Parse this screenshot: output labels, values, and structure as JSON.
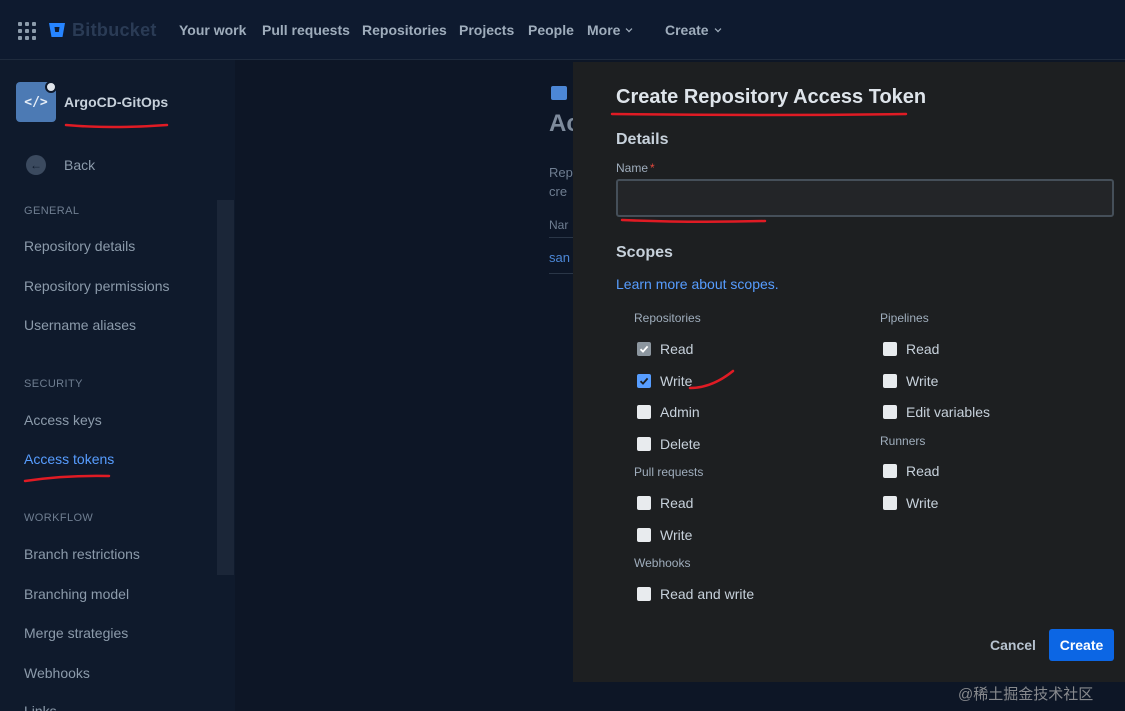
{
  "topnav": {
    "logo": "Bitbucket",
    "items": [
      "Your work",
      "Pull requests",
      "Repositories",
      "Projects",
      "People",
      "More"
    ],
    "create_label": "Create"
  },
  "sidebar": {
    "repo_name": "ArgoCD-GitOps",
    "repo_avatar_glyph": "</>",
    "back_label": "Back",
    "sections": [
      {
        "heading": "GENERAL",
        "items": [
          "Repository details",
          "Repository permissions",
          "Username aliases"
        ]
      },
      {
        "heading": "SECURITY",
        "items": [
          "Access keys",
          "Access tokens"
        ]
      },
      {
        "heading": "WORKFLOW",
        "items": [
          "Branch restrictions",
          "Branching model",
          "Merge strategies",
          "Webhooks",
          "Links"
        ]
      }
    ],
    "active_item": "Access tokens"
  },
  "background_page": {
    "title_fragment": "Ac",
    "desc_fragment_1": "Rep",
    "desc_fragment_2": "cre",
    "column_fragment": "Nar",
    "link_fragment": "san"
  },
  "modal": {
    "title": "Create Repository Access Token",
    "details_heading": "Details",
    "name_label": "Name",
    "required_mark": "*",
    "name_value": "",
    "scopes_heading": "Scopes",
    "scopes_link": "Learn more about scopes.",
    "groups": {
      "repositories": {
        "heading": "Repositories",
        "options": [
          {
            "label": "Read",
            "checked": true,
            "disabled": true
          },
          {
            "label": "Write",
            "checked": true,
            "disabled": false
          },
          {
            "label": "Admin",
            "checked": false,
            "disabled": false
          },
          {
            "label": "Delete",
            "checked": false,
            "disabled": false
          }
        ]
      },
      "pull_requests": {
        "heading": "Pull requests",
        "options": [
          {
            "label": "Read",
            "checked": false,
            "disabled": false
          },
          {
            "label": "Write",
            "checked": false,
            "disabled": false
          }
        ]
      },
      "webhooks": {
        "heading": "Webhooks",
        "options": [
          {
            "label": "Read and write",
            "checked": false,
            "disabled": false
          }
        ]
      },
      "pipelines": {
        "heading": "Pipelines",
        "options": [
          {
            "label": "Read",
            "checked": false,
            "disabled": false
          },
          {
            "label": "Write",
            "checked": false,
            "disabled": false
          },
          {
            "label": "Edit variables",
            "checked": false,
            "disabled": false
          }
        ]
      },
      "runners": {
        "heading": "Runners",
        "options": [
          {
            "label": "Read",
            "checked": false,
            "disabled": false
          },
          {
            "label": "Write",
            "checked": false,
            "disabled": false
          }
        ]
      }
    },
    "cancel_label": "Cancel",
    "create_label": "Create"
  },
  "colors": {
    "primary": "#0c66e4",
    "link": "#579dff",
    "annotation": "#e01b24",
    "modal_bg": "#1d1f21",
    "page_bg": "#0d1626"
  },
  "watermark": "@稀土掘金技术社区"
}
